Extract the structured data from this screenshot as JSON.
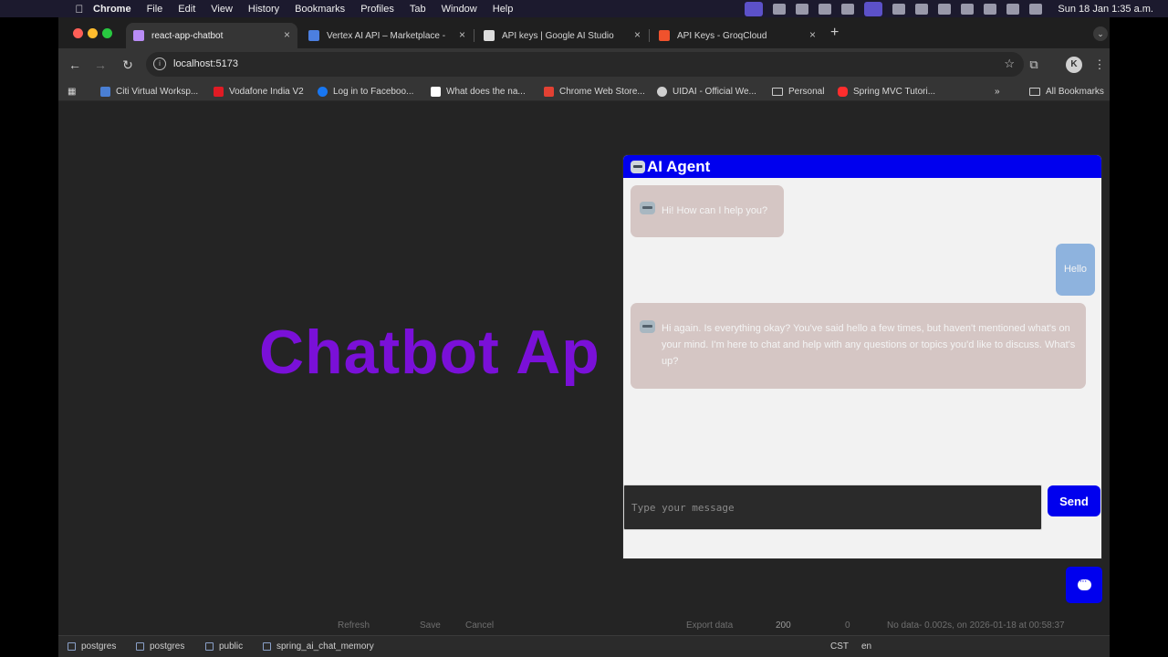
{
  "menubar": {
    "app": "Chrome",
    "items": [
      "File",
      "Edit",
      "View",
      "History",
      "Bookmarks",
      "Profiles",
      "Tab",
      "Window",
      "Help"
    ],
    "clock": "Sun 18 Jan  1:35 a.m."
  },
  "tabs": [
    {
      "label": "react-app-chatbot",
      "active": true,
      "favicon_color": "#b98cf5"
    },
    {
      "label": "Vertex AI API – Marketplace -",
      "active": false,
      "favicon_color": "#4c7fe0"
    },
    {
      "label": "API keys | Google AI Studio",
      "active": false,
      "favicon_color": "#dddddd"
    },
    {
      "label": "API Keys - GroqCloud",
      "active": false,
      "favicon_color": "#f0522d"
    }
  ],
  "toolbar": {
    "url": "localhost:5173"
  },
  "bookmarks": [
    {
      "label": "Citi Virtual Worksp...",
      "color": "#4a7fd4"
    },
    {
      "label": "Vodafone India V2",
      "color": "#e01b24"
    },
    {
      "label": "Log in to Faceboo...",
      "color": "#1877f2"
    },
    {
      "label": "What does the na...",
      "color": "#ffffff"
    },
    {
      "label": "Chrome Web Store...",
      "color": "#e34133"
    },
    {
      "label": "UIDAI - Official We...",
      "color": "#cfcfcf"
    },
    {
      "label": "Personal",
      "folder": true
    },
    {
      "label": "Spring MVC Tutori...",
      "color": "#ff2d2d"
    }
  ],
  "all_bookmarks": "All Bookmarks",
  "page": {
    "hero_title": "Chatbot Ap"
  },
  "chat": {
    "title": "AI Agent",
    "messages": [
      {
        "role": "bot",
        "text": "Hi! How can I help you?"
      },
      {
        "role": "user",
        "text": "Hello"
      },
      {
        "role": "bot",
        "text": "Hi again. Is everything okay? You've said hello a few times, but haven't mentioned what's on your mind. I'm here to chat and help with any questions or topics you'd like to discuss. What's up?"
      }
    ],
    "input_placeholder": "Type your message",
    "send_label": "Send"
  },
  "db_panel": {
    "refresh": "Refresh",
    "save": "Save",
    "cancel": "Cancel",
    "export": "Export data",
    "limit": "200",
    "count": "0",
    "status": "No data- 0.002s, on 2026-01-18 at 00:58:37"
  },
  "statusbar": {
    "crumbs": [
      "postgres",
      "postgres",
      "public",
      "spring_ai_chat_memory"
    ],
    "tz": "CST",
    "lang": "en"
  }
}
